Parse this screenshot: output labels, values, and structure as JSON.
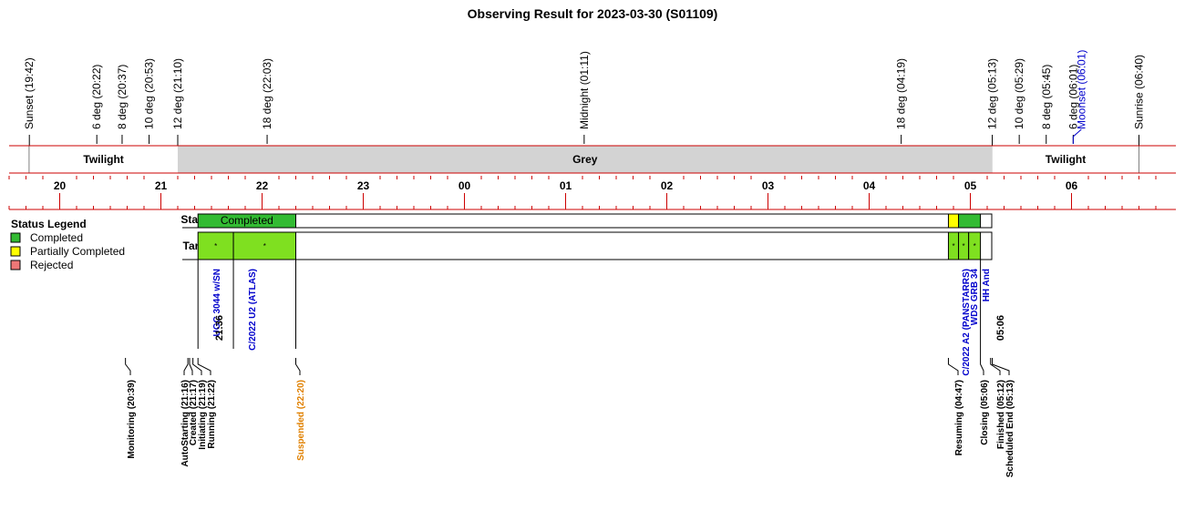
{
  "chart_data": {
    "type": "timeline",
    "title": "Observing Result for 2023-03-30 (S01109)",
    "time_axis": {
      "start": "19:30",
      "end": "06:50",
      "hour_ticks": [
        "20",
        "21",
        "22",
        "23",
        "00",
        "01",
        "02",
        "03",
        "04",
        "05",
        "06"
      ]
    },
    "sky_events": [
      {
        "label": "Sunset (19:42)",
        "time": "19:42"
      },
      {
        "label": "6 deg (20:22)",
        "time": "20:22"
      },
      {
        "label": "8 deg (20:37)",
        "time": "20:37"
      },
      {
        "label": "10 deg (20:53)",
        "time": "20:53"
      },
      {
        "label": "12 deg (21:10)",
        "time": "21:10"
      },
      {
        "label": "18 deg (22:03)",
        "time": "22:03"
      },
      {
        "label": "Midnight (01:11)",
        "time": "01:11"
      },
      {
        "label": "18 deg (04:19)",
        "time": "04:19"
      },
      {
        "label": "12 deg (05:13)",
        "time": "05:13"
      },
      {
        "label": "10 deg (05:29)",
        "time": "05:29"
      },
      {
        "label": "8 deg (05:45)",
        "time": "05:45"
      },
      {
        "label": "6 deg (06:01)",
        "time": "06:01"
      },
      {
        "label": "Moonset (06:01)",
        "time": "06:01",
        "color": "#0000cc"
      },
      {
        "label": "Sunrise (06:40)",
        "time": "06:40"
      }
    ],
    "periods": [
      {
        "label": "Twilight",
        "start": "19:42",
        "end": "21:10",
        "color": "#ffffff"
      },
      {
        "label": "Grey",
        "start": "21:10",
        "end": "05:13",
        "color": "#d3d3d3"
      },
      {
        "label": "Twilight",
        "start": "05:13",
        "end": "06:40",
        "color": "#ffffff"
      }
    ],
    "rows": {
      "status": "Status",
      "targets": "Targets"
    },
    "legend": {
      "title": "Status Legend",
      "items": [
        {
          "label": "Completed",
          "color": "#33bb33"
        },
        {
          "label": "Partially Completed",
          "color": "#ffff00"
        },
        {
          "label": "Rejected",
          "color": "#ee7777"
        }
      ]
    },
    "status_segments": [
      {
        "label": "Completed",
        "start": "21:22",
        "end": "22:20",
        "color": "#33bb33"
      },
      {
        "label": "",
        "start": "04:47",
        "end": "04:53",
        "color": "#ffff00"
      },
      {
        "label": "",
        "start": "04:53",
        "end": "05:06",
        "color": "#33bb33"
      }
    ],
    "targets": [
      {
        "name": "UGC 3044 w/SN",
        "start": "21:22",
        "end": "21:43",
        "marker": "*"
      },
      {
        "name": "C/2022 U2 (ATLAS)",
        "start": "21:43",
        "end": "22:20",
        "marker": "*"
      },
      {
        "name": "C/2022 A2 (PANSTARRS)",
        "start": "04:47",
        "end": "04:53",
        "marker": "*"
      },
      {
        "name": "WDS GRB 34",
        "start": "04:53",
        "end": "04:59",
        "marker": "*"
      },
      {
        "name": "HH And",
        "start": "04:59",
        "end": "05:06",
        "marker": "*"
      }
    ],
    "time_marks": [
      {
        "label": "21:36",
        "time": "21:36"
      },
      {
        "label": "05:06",
        "time": "05:06"
      }
    ],
    "events": [
      {
        "label": "Monitoring (20:39)",
        "time": "20:39",
        "color": "#000000"
      },
      {
        "label": "AutoStarting (21:16)",
        "time": "21:16",
        "color": "#000000"
      },
      {
        "label": "Created (21:17)",
        "time": "21:17",
        "color": "#000000"
      },
      {
        "label": "Initiating (21:19)",
        "time": "21:19",
        "color": "#000000"
      },
      {
        "label": "Running (21:22)",
        "time": "21:22",
        "color": "#000000"
      },
      {
        "label": "Suspended (22:20)",
        "time": "22:20",
        "color": "#e08000"
      },
      {
        "label": "Resuming (04:47)",
        "time": "04:47",
        "color": "#000000"
      },
      {
        "label": "Closing (05:06)",
        "time": "05:06",
        "color": "#000000"
      },
      {
        "label": "Finished (05:12)",
        "time": "05:12",
        "color": "#000000"
      },
      {
        "label": "Scheduled End (05:13)",
        "time": "05:13",
        "color": "#000000"
      }
    ]
  }
}
